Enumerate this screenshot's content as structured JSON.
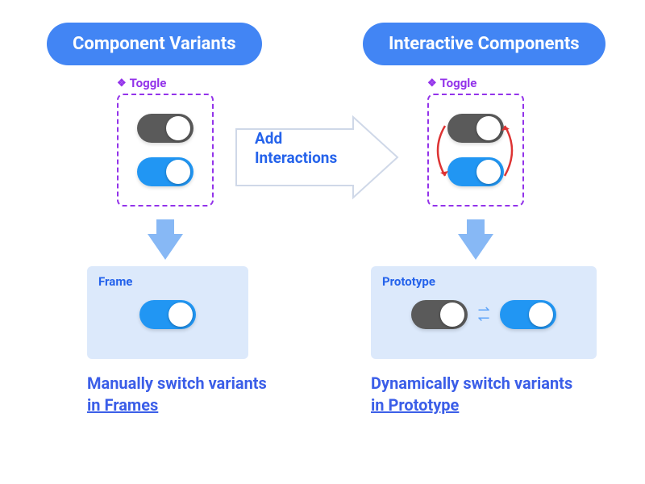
{
  "pills": {
    "left": "Component Variants",
    "right": "Interactive Components"
  },
  "toggleLabels": {
    "left": "Toggle",
    "right": "Toggle"
  },
  "bigArrow": {
    "line1": "Add",
    "line2": "Interactions"
  },
  "results": {
    "left": {
      "label": "Frame"
    },
    "right": {
      "label": "Prototype"
    }
  },
  "captions": {
    "left": {
      "line1": "Manually switch variants",
      "line2": "in Frames"
    },
    "right": {
      "line1": "Dynamically switch variants",
      "line2": "in Prototype"
    }
  }
}
